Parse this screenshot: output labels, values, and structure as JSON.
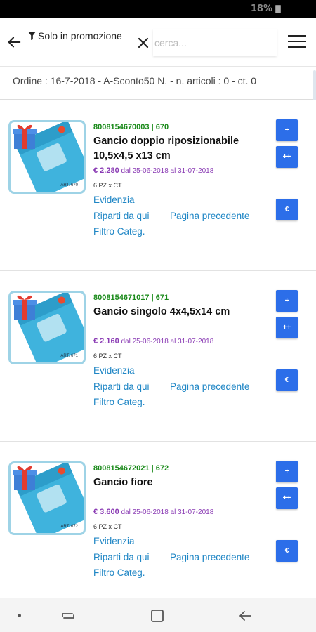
{
  "status": {
    "battery": "18%"
  },
  "header": {
    "filter_label": "Solo in promozione",
    "search_placeholder": "cerca..."
  },
  "order_line": "Ordine : 16-7-2018 - A-Sconto50 N. - n. articoli : 0 - ct. 0",
  "products": [
    {
      "code": "8008154670003 | 670",
      "name": "Gancio doppio riposizionabile 10,5x4,5 x13 cm",
      "price": "€ 2.280",
      "period": "dal 25-06-2018 al 31-07-2018",
      "pack": "6 PZ x CT",
      "art": "ART. 670"
    },
    {
      "code": "8008154671017 | 671",
      "name": "Gancio singolo 4x4,5x14 cm",
      "price": "€ 2.160",
      "period": "dal 25-06-2018 al 31-07-2018",
      "pack": "6 PZ x CT",
      "art": "ART. 671"
    },
    {
      "code": "8008154672021 | 672",
      "name": "Gancio fiore",
      "price": "€ 3.600",
      "period": "dal 25-06-2018 al 31-07-2018",
      "pack": "6 PZ x CT",
      "art": "ART. 672"
    }
  ],
  "labels": {
    "evidenzia": "Evidenzia",
    "riparti": "Riparti da qui",
    "pagina_precedente": "Pagina precedente",
    "filtro": "Filtro Categ.",
    "btn_plus": "+",
    "btn_plusplus": "++",
    "btn_euro": "€"
  },
  "colors": {
    "accent_button": "#2c6ee9",
    "code_green": "#1a8a1a",
    "price_purple": "#8a3bb4",
    "link_blue": "#1f86c5"
  }
}
